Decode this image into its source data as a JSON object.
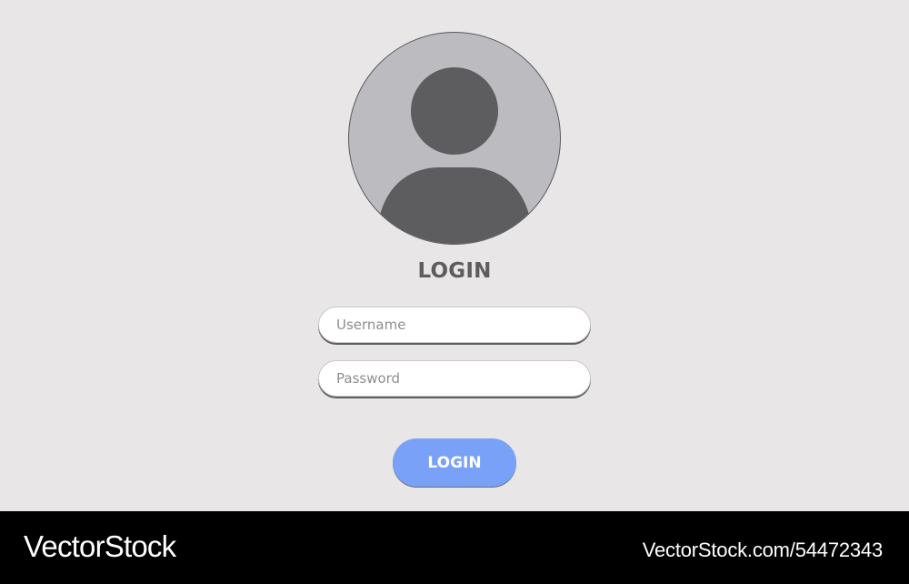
{
  "colors": {
    "background": "#e8e6e7",
    "avatar_background": "#bcbbbf",
    "avatar_figure": "#5d5d60",
    "title_text": "#5d5d60",
    "button_background": "#7aa1f8",
    "footer_background": "#000000"
  },
  "avatar": {
    "icon": "user-silhouette-icon"
  },
  "login_form": {
    "title": "LOGIN",
    "username": {
      "placeholder": "Username",
      "value": ""
    },
    "password": {
      "placeholder": "Password",
      "value": ""
    },
    "submit_label": "LOGIN"
  },
  "footer": {
    "brand": "VectorStock",
    "image_id": "VectorStock.com/54472343"
  }
}
